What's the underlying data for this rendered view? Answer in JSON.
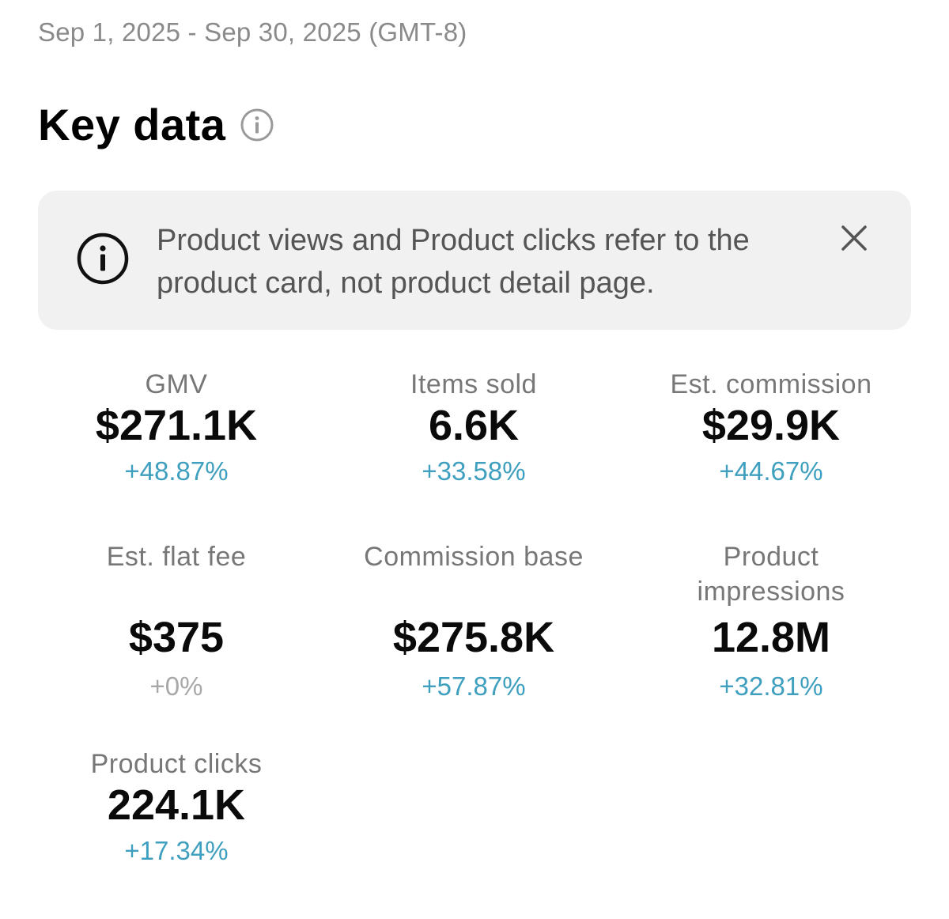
{
  "date_range": "Sep 1, 2025 - Sep 30, 2025 (GMT-8)",
  "title": "Key data",
  "title_info_icon": "info-circle-icon",
  "notice": {
    "icon": "info-circle-icon",
    "text": "Product views and Product clicks refer to the product card, not product detail page.",
    "close_icon": "close-icon"
  },
  "colors": {
    "positive_change": "#3f9fbe",
    "neutral_change": "#a8a8a8",
    "notice_background": "#f1f1f1"
  },
  "metrics": [
    {
      "label": "GMV",
      "value": "$271.1K",
      "change": "+48.87%"
    },
    {
      "label": "Items sold",
      "value": "6.6K",
      "change": "+33.58%"
    },
    {
      "label": "Est. commission",
      "value": "$29.9K",
      "change": "+44.67%"
    },
    {
      "label": "Est. flat fee",
      "value": "$375",
      "change": "+0%"
    },
    {
      "label": "Commission base",
      "value": "$275.8K",
      "change": "+57.87%"
    },
    {
      "label": "Product impressions",
      "value": "12.8M",
      "change": "+32.81%"
    },
    {
      "label": "Product clicks",
      "value": "224.1K",
      "change": "+17.34%"
    }
  ]
}
